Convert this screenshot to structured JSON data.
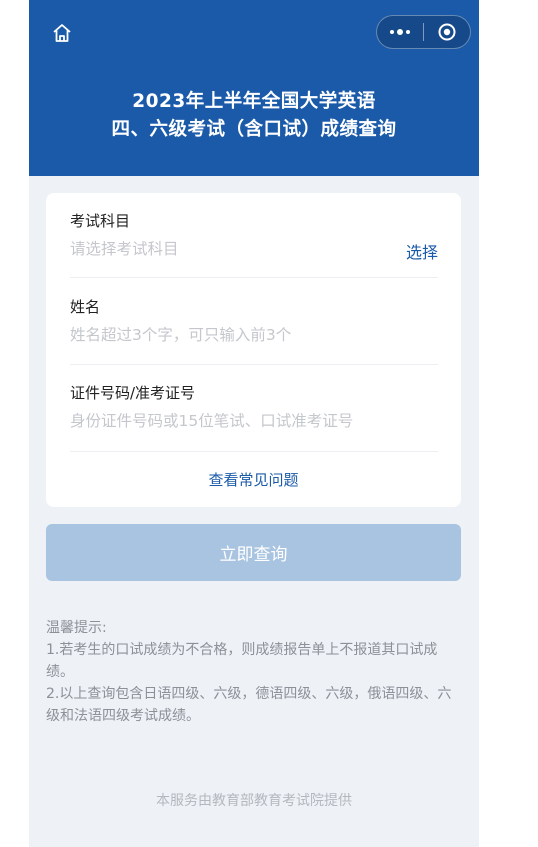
{
  "header": {
    "title_line1": "2023年上半年全国大学英语",
    "title_line2": "四、六级考试（含口试）成绩查询",
    "background_color": "#1a5aa9",
    "home_icon": "home-icon",
    "more_icon": "more-dots-icon",
    "close_icon": "target-close-icon"
  },
  "form": {
    "subject": {
      "label": "考试科目",
      "placeholder": "请选择考试科目",
      "action_label": "选择"
    },
    "name": {
      "label": "姓名",
      "placeholder": "姓名超过3个字，可只输入前3个"
    },
    "id_number": {
      "label": "证件号码/准考证号",
      "placeholder": "身份证件号码或15位笔试、口试准考证号"
    },
    "faq_link": "查看常见问题"
  },
  "submit_button": {
    "label": "立即查询",
    "color": "#a9c4e1"
  },
  "tips": {
    "title": "温馨提示:",
    "line1": "1.若考生的口试成绩为不合格，则成绩报告单上不报道其口试成绩。",
    "line2": "2.以上查询包含日语四级、六级，德语四级、六级，俄语四级、六级和法语四级考试成绩。"
  },
  "footer": {
    "text": "本服务由教育部教育考试院提供"
  }
}
